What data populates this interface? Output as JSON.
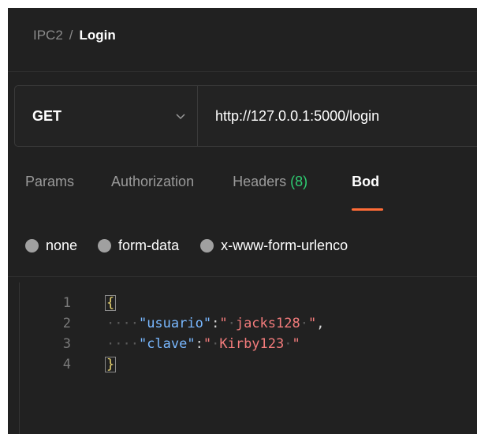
{
  "breadcrumb": {
    "parent": "IPC2",
    "separator": "/",
    "current": "Login"
  },
  "request": {
    "method": "GET",
    "url": "http://127.0.0.1:5000/login"
  },
  "tabs": [
    {
      "label": "Params"
    },
    {
      "label": "Authorization"
    },
    {
      "label": "Headers",
      "count": "(8)"
    },
    {
      "label": "Bod"
    }
  ],
  "body_types": [
    "none",
    "form-data",
    "x-www-form-urlenco"
  ],
  "editor": {
    "line_numbers": [
      "1",
      "2",
      "3",
      "4"
    ],
    "open_brace": "{",
    "close_brace": "}",
    "indent": "····",
    "pairs": [
      {
        "key": "\"usuario\"",
        "colon": ":",
        "open_quote": "\"",
        "value": "jacks128",
        "close_quote": "\"",
        "comma": ","
      },
      {
        "key": "\"clave\"",
        "colon": ":",
        "open_quote": "\"",
        "value": "Kirby123",
        "close_quote": "\"",
        "comma": ""
      }
    ]
  },
  "colors": {
    "background": "#212121",
    "accent": "#ff6c37",
    "count_green": "#2ecc71",
    "json_key": "#79b8ff",
    "json_string": "#f47c7c"
  }
}
